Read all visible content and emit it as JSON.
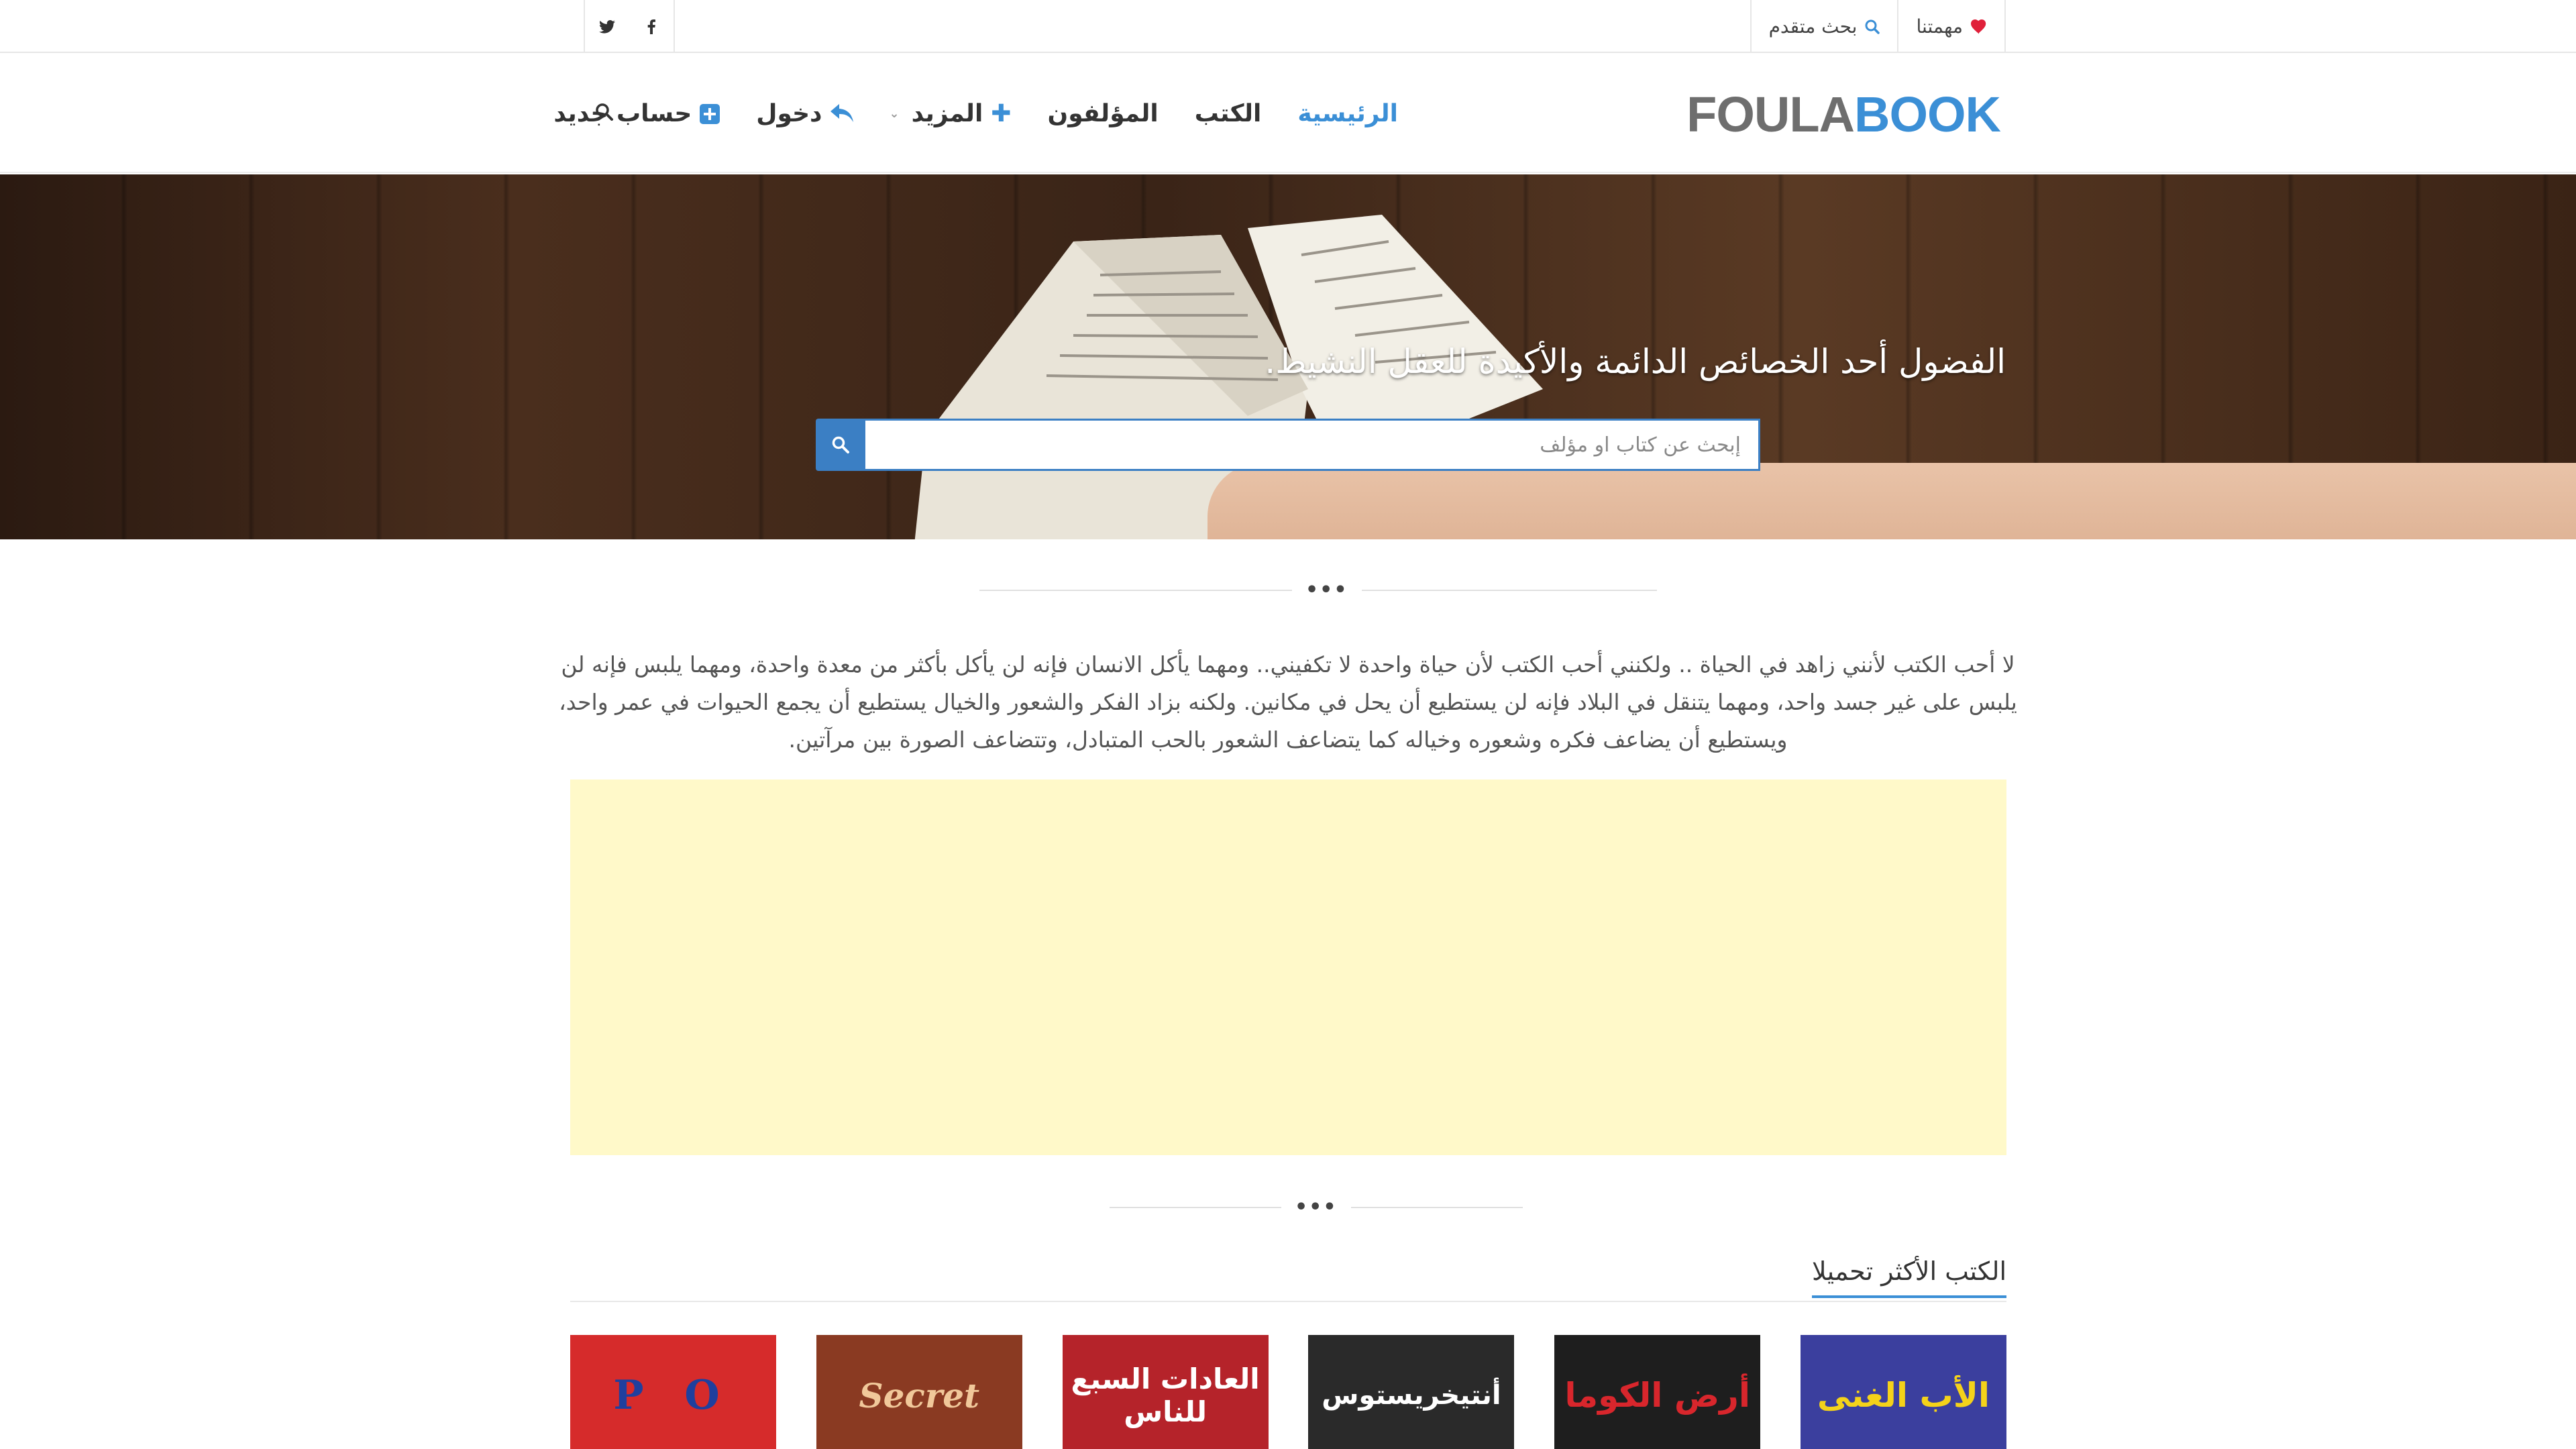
{
  "topbar": {
    "mission_label": "مهمتنا",
    "advanced_search_label": "بحث متقدم",
    "social": [
      "facebook-icon",
      "twitter-icon"
    ]
  },
  "header": {
    "logo_part1": "FOULA",
    "logo_part2": "BOOK",
    "nav": {
      "home": "الرئيسية",
      "books": "الكتب",
      "authors": "المؤلفون",
      "more": "المزيد",
      "login": "دخول",
      "register": "حساب جديد"
    }
  },
  "hero": {
    "title": "الفضول أحد الخصائص الدائمة والأكيدة للعقل النشيط.",
    "search_placeholder": "إبحث عن كتاب او مؤلف"
  },
  "intro": {
    "text": "لا أحب الكتب لأنني زاهد في الحياة .. ولكنني أحب الكتب لأن حياة واحدة لا تكفيني.. ومهما يأكل الانسان فإنه لن يأكل بأكثر من معدة واحدة، ومهما يلبس فإنه لن يلبس على غير جسد واحد، ومهما يتنقل في البلاد فإنه لن يستطيع أن يحل في مكانين. ولكنه بزاد الفكر والشعور والخيال يستطيع أن يجمع الحيوات في عمر واحد، ويستطيع أن يضاعف فكره وشعوره وخياله كما يتضاعف الشعور بالحب المتبادل، وتتضاعف الصورة بين مرآتين."
  },
  "divider": {
    "dots": "•••"
  },
  "most_downloaded": {
    "title": "الكتب الأكثر تحميلا",
    "books": [
      {
        "cover_text": "الأب الغنى",
        "bg": "#3b3f9e",
        "fg": "#f4d21a"
      },
      {
        "cover_text": "أرض الكوما",
        "bg": "#1e1e1e",
        "fg": "#d8262c"
      },
      {
        "cover_text": "أنتيخريستوس",
        "bg": "#2a2a2a",
        "fg": "#ffffff"
      },
      {
        "cover_text": "العادات السبع للناس",
        "bg": "#b5232a",
        "fg": "#ffffff"
      },
      {
        "cover_text": "Secret",
        "bg": "#8a3a22",
        "fg": "#f1c89a"
      },
      {
        "cover_text": "P O",
        "bg": "#d62b2b",
        "fg": "#1f3f9e"
      }
    ]
  },
  "colors": {
    "accent": "#3b8fd6",
    "search_button": "#3b7fc4",
    "heart": "#e0203a",
    "ad_background": "#fff9c9"
  }
}
